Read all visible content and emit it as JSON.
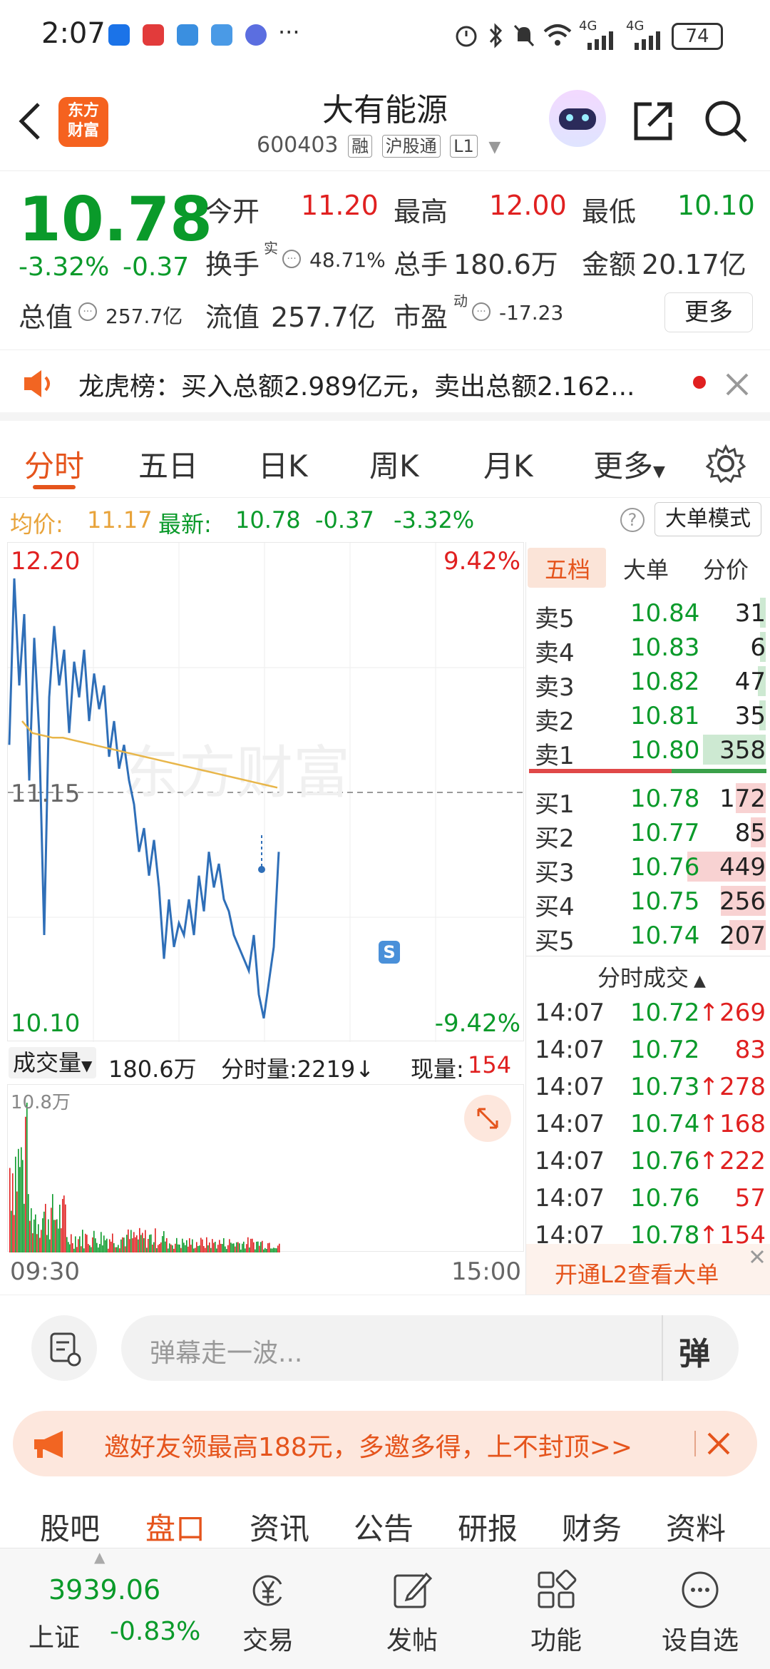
{
  "status_bar": {
    "time": "2:07",
    "battery": "74",
    "signal_1": "4G",
    "signal_2": "4G",
    "more": "···"
  },
  "header": {
    "back_icon": "chevron-left-icon",
    "logo_text_top": "东方",
    "logo_text_bottom": "财富",
    "stock_name": "大有能源",
    "stock_code": "600403",
    "tags": [
      "融",
      "沪股通",
      "L1"
    ]
  },
  "quote": {
    "price": "10.78",
    "change_pct": "-3.32%",
    "change_abs": "-0.37",
    "open_label": "今开",
    "open_value": "11.20",
    "high_label": "最高",
    "high_value": "12.00",
    "low_label": "最低",
    "low_value": "10.10",
    "turnover_label": "换手",
    "turnover_sup": "实",
    "turnover_value": "48.71%",
    "volume_label": "总手",
    "volume_value": "180.6万",
    "amount_label": "金额",
    "amount_value": "20.17亿",
    "mktcap_label": "总值",
    "mktcap_value": "257.7亿",
    "float_label": "流值",
    "float_value": "257.7亿",
    "pe_label": "市盈",
    "pe_sup": "动",
    "pe_value": "-17.23",
    "more_button": "更多"
  },
  "notice": {
    "text": "龙虎榜：买入总额2.989亿元，卖出总额2.162..."
  },
  "tabs": {
    "items": [
      "分时",
      "五日",
      "日K",
      "周K",
      "月K",
      "更多"
    ],
    "active": "分时"
  },
  "infobar": {
    "avg_label": "均价:",
    "avg_value": "11.17",
    "latest_label": "最新:",
    "latest_value": "10.78",
    "latest_change": "-0.37",
    "latest_pct": "-3.32%",
    "mode_button": "大单模式"
  },
  "chart_data": {
    "type": "line",
    "y_max_label": "12.20",
    "y_min_label": "10.10",
    "y_mid_label": "11.15",
    "pct_max_label": "9.42%",
    "pct_min_label": "-9.42%",
    "ylim": [
      10.1,
      12.2
    ],
    "prev_close": 11.15,
    "x_start": "09:30",
    "x_end": "15:00",
    "price_series": [
      11.35,
      12.05,
      11.6,
      11.9,
      11.2,
      11.8,
      11.4,
      10.55,
      11.55,
      11.85,
      11.6,
      11.75,
      11.4,
      11.7,
      11.55,
      11.75,
      11.45,
      11.65,
      11.5,
      11.6,
      11.3,
      11.45,
      11.25,
      11.35,
      11.2,
      11.1,
      10.9,
      11.0,
      10.8,
      10.95,
      10.75,
      10.45,
      10.7,
      10.5,
      10.6,
      10.55,
      10.7,
      10.55,
      10.8,
      10.65,
      10.9,
      10.75,
      10.85,
      10.7,
      10.65,
      10.55,
      10.5,
      10.45,
      10.4,
      10.55,
      10.3,
      10.2,
      10.35,
      10.5,
      10.9
    ],
    "avg_series": [
      11.45,
      11.4,
      11.39,
      11.38,
      11.38,
      11.37,
      11.36,
      11.35,
      11.34,
      11.33,
      11.32,
      11.31,
      11.3,
      11.29,
      11.28,
      11.27,
      11.26,
      11.25,
      11.24,
      11.23,
      11.22,
      11.21,
      11.2,
      11.19,
      11.18,
      11.17
    ],
    "marker_label": "S",
    "volume": {
      "label": "成交量",
      "total": "180.6万",
      "tick_label": "分时量:2219",
      "current_label": "现量:",
      "current_value": "154",
      "max_label": "10.8万"
    }
  },
  "orderbook": {
    "tabs": [
      "五档",
      "大单",
      "分价"
    ],
    "sells": [
      {
        "label": "卖5",
        "price": "10.84",
        "vol": "31"
      },
      {
        "label": "卖4",
        "price": "10.83",
        "vol": "6"
      },
      {
        "label": "卖3",
        "price": "10.82",
        "vol": "47"
      },
      {
        "label": "卖2",
        "price": "10.81",
        "vol": "35"
      },
      {
        "label": "卖1",
        "price": "10.80",
        "vol": "358"
      }
    ],
    "buys": [
      {
        "label": "买1",
        "price": "10.78",
        "vol": "172"
      },
      {
        "label": "买2",
        "price": "10.77",
        "vol": "85"
      },
      {
        "label": "买3",
        "price": "10.76",
        "vol": "449"
      },
      {
        "label": "买4",
        "price": "10.75",
        "vol": "256"
      },
      {
        "label": "买5",
        "price": "10.74",
        "vol": "207"
      }
    ],
    "ticks_title": "分时成交",
    "ticks": [
      {
        "time": "14:07",
        "price": "10.72",
        "arrow": "↑",
        "vol": "269"
      },
      {
        "time": "14:07",
        "price": "10.72",
        "arrow": "",
        "vol": "83"
      },
      {
        "time": "14:07",
        "price": "10.73",
        "arrow": "↑",
        "vol": "278"
      },
      {
        "time": "14:07",
        "price": "10.74",
        "arrow": "↑",
        "vol": "168"
      },
      {
        "time": "14:07",
        "price": "10.76",
        "arrow": "↑",
        "vol": "222"
      },
      {
        "time": "14:07",
        "price": "10.76",
        "arrow": "",
        "vol": "57"
      },
      {
        "time": "14:07",
        "price": "10.78",
        "arrow": "↑",
        "vol": "154"
      }
    ],
    "l2_banner": "开通L2查看大单"
  },
  "commentbar": {
    "placeholder": "弹幕走一波...",
    "danmu_button": "弹"
  },
  "promo": {
    "text": "邀好友领最高188元，多邀多得，上不封顶>>"
  },
  "subtabs": {
    "items": [
      "股吧",
      "盘口",
      "资讯",
      "公告",
      "研报",
      "财务",
      "资料"
    ],
    "active": "盘口"
  },
  "bottomnav": {
    "index_value": "3939.06",
    "index_name": "上证",
    "index_pct": "-0.83%",
    "items": [
      "交易",
      "发帖",
      "功能",
      "设自选"
    ]
  },
  "colors": {
    "up": "#e02020",
    "down": "#0a9a2a",
    "accent": "#e5541c",
    "price_line": "#2f6fb8",
    "avg_line": "#e8b64a"
  }
}
